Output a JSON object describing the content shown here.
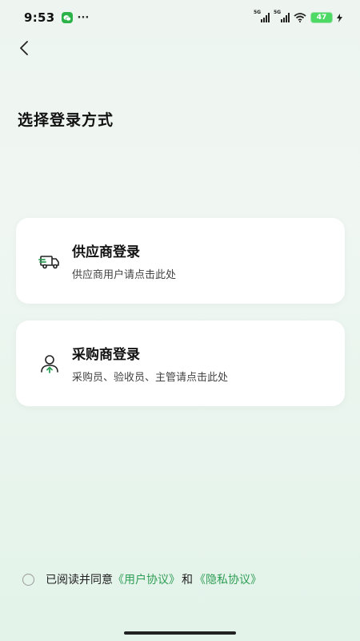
{
  "status_bar": {
    "time": "9:53",
    "more": "···",
    "signal_1": "5G",
    "signal_2": "5G",
    "battery": "47"
  },
  "header": {
    "back_icon": "chevron-left-icon",
    "title": "选择登录方式"
  },
  "options": [
    {
      "icon": "delivery-truck-icon",
      "title": "供应商登录",
      "subtitle": "供应商用户请点击此处"
    },
    {
      "icon": "user-upload-icon",
      "title": "采购商登录",
      "subtitle": "采购员、验收员、主管请点击此处"
    }
  ],
  "agreement": {
    "prefix": "已阅读并同意",
    "user_agreement": "《用户协议》",
    "and": "和",
    "privacy_agreement": "《隐私协议》"
  },
  "colors": {
    "accent": "#2f9e55",
    "battery": "#4cd964",
    "background": "#eef5f1"
  }
}
